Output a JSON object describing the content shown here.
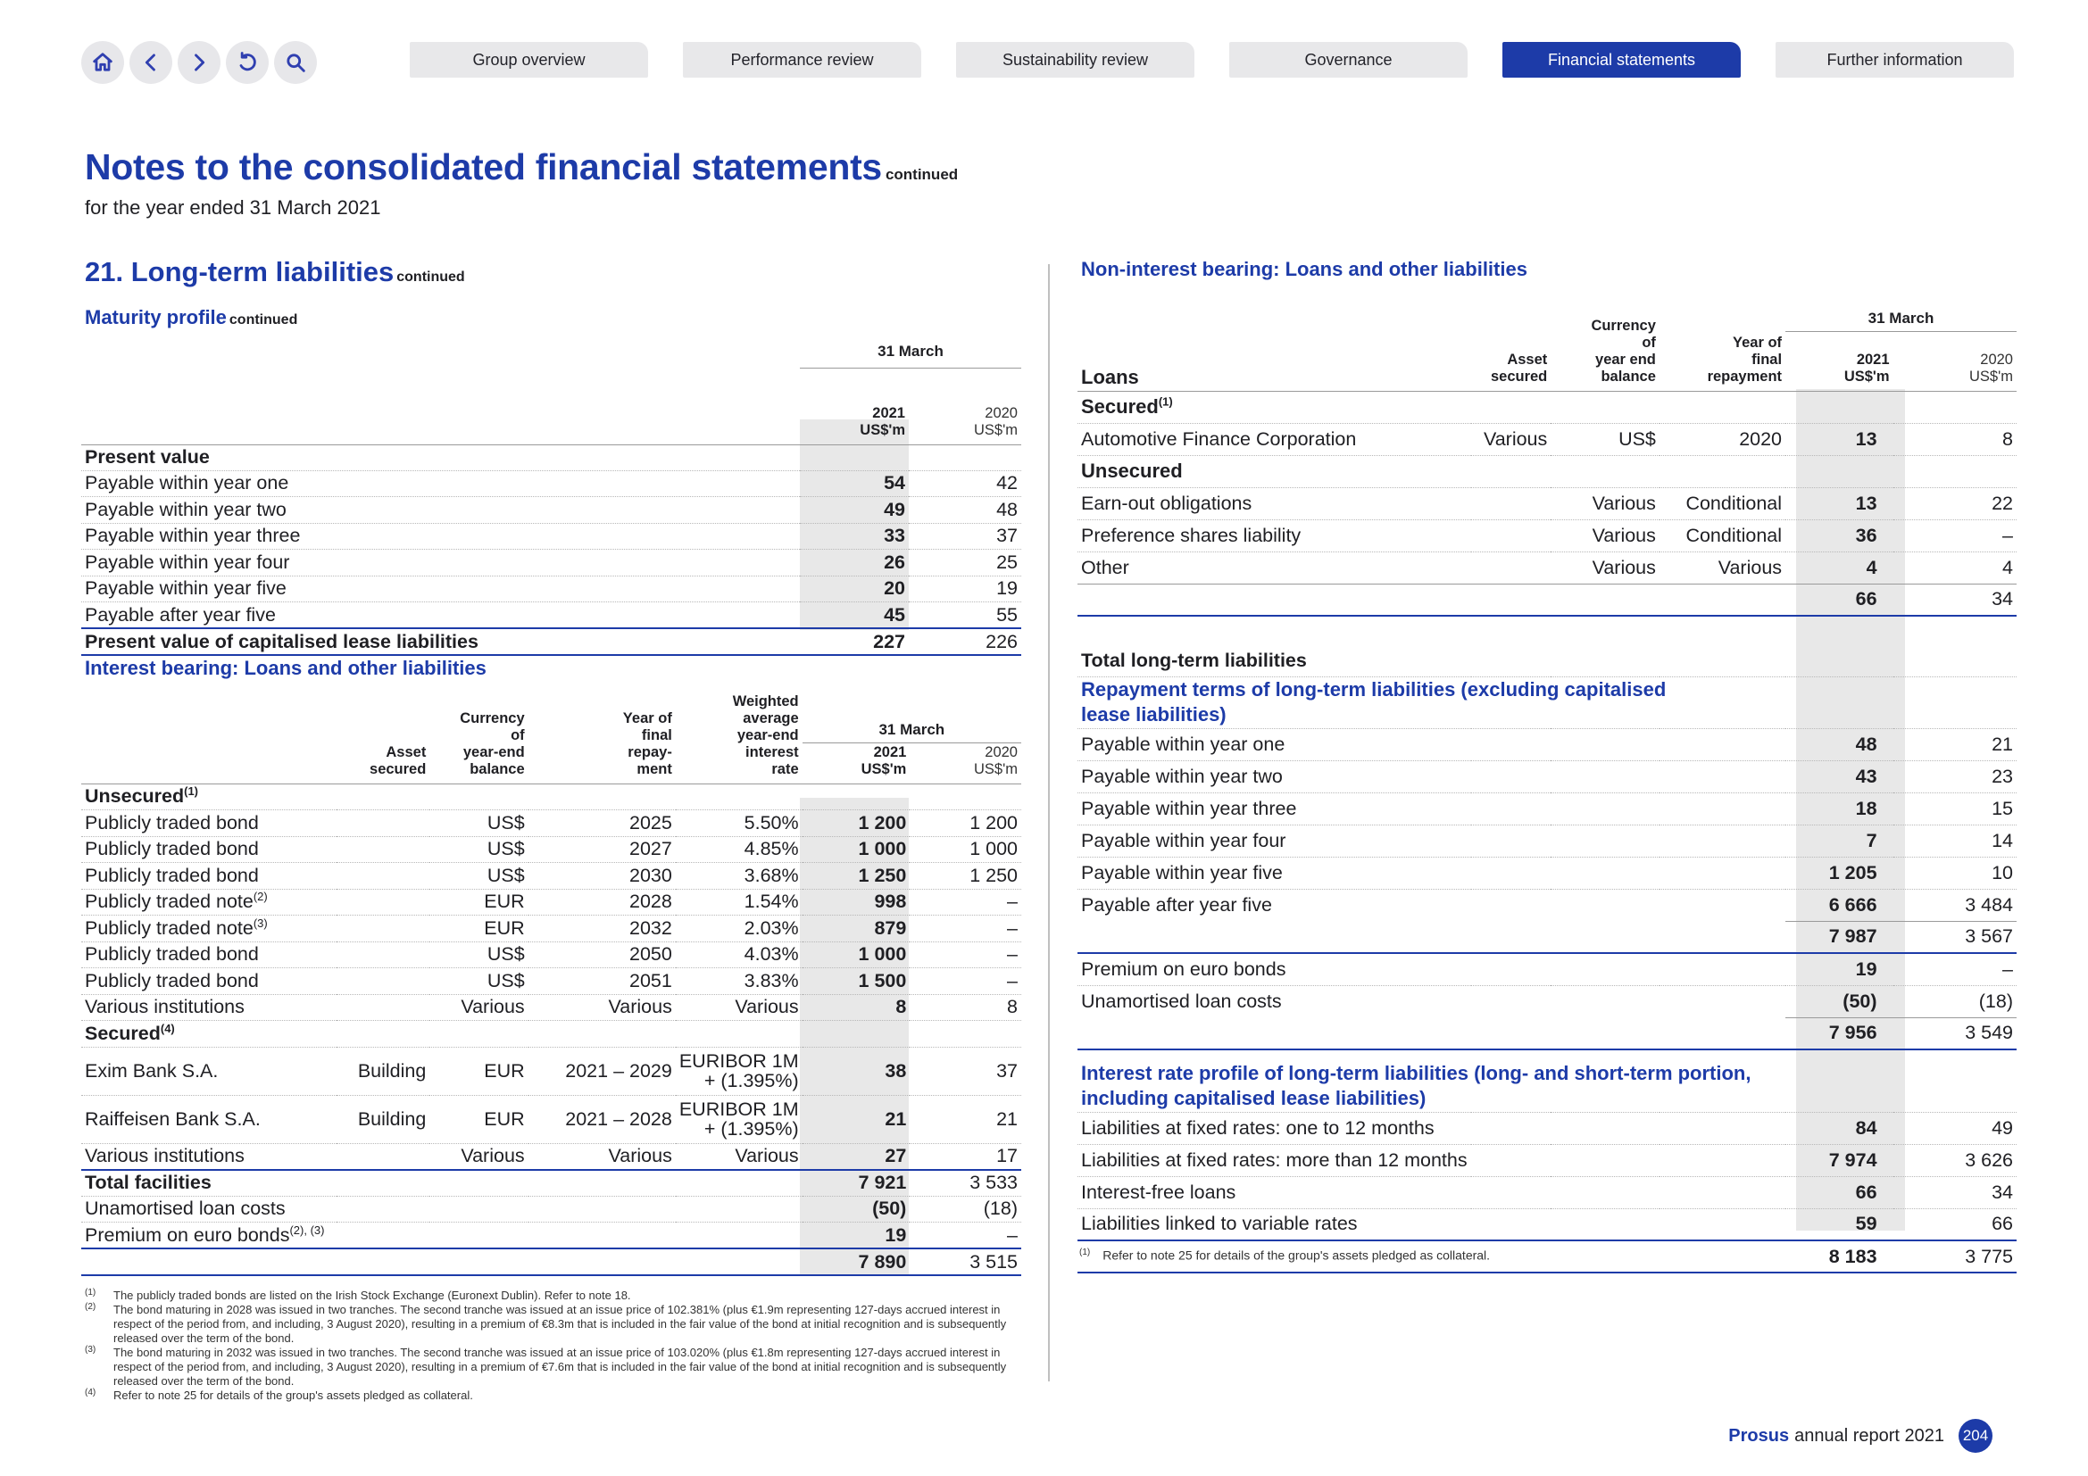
{
  "nav": {
    "tabs": [
      "Group overview",
      "Performance review",
      "Sustainability review",
      "Governance",
      "Financial statements",
      "Further information"
    ],
    "active_tab": "Financial statements"
  },
  "header": {
    "title": "Notes to the consolidated financial statements",
    "title_suffix": "continued",
    "subtitle": "for the year ended 31 March 2021"
  },
  "section": {
    "title": "21. Long-term liabilities",
    "suffix": "continued"
  },
  "maturity": {
    "title": "Maturity profile",
    "suffix": "continued",
    "march": "31 March",
    "col2021": [
      "2021",
      "US$'m"
    ],
    "col2020": [
      "2020",
      "US$'m"
    ],
    "heading": "Present value",
    "rows": [
      {
        "label": "Payable within year one",
        "v2021": "54",
        "v2020": "42"
      },
      {
        "label": "Payable within year two",
        "v2021": "49",
        "v2020": "48"
      },
      {
        "label": "Payable within year three",
        "v2021": "33",
        "v2020": "37"
      },
      {
        "label": "Payable within year four",
        "v2021": "26",
        "v2020": "25"
      },
      {
        "label": "Payable within year five",
        "v2021": "20",
        "v2020": "19"
      },
      {
        "label": "Payable after year five",
        "v2021": "45",
        "v2020": "55"
      }
    ],
    "total": {
      "label": "Present value of capitalised lease liabilities",
      "v2021": "227",
      "v2020": "226"
    }
  },
  "interest": {
    "title": "Interest bearing: Loans and other liabilities",
    "headers": {
      "asset": [
        "Asset",
        "secured"
      ],
      "currency": [
        "Currency",
        "of",
        "year-end",
        "balance"
      ],
      "year": [
        "Year of",
        "final",
        "repay-",
        "ment"
      ],
      "rate": [
        "Weighted",
        "average",
        "year-end",
        "interest",
        "rate"
      ],
      "march": "31 March",
      "c2021": [
        "2021",
        "US$'m"
      ],
      "c2020": [
        "2020",
        "US$'m"
      ]
    },
    "unsecured_label": "Unsecured",
    "unsecured_sup": "(1)",
    "unsecured": [
      {
        "label": "Publicly traded bond",
        "sup": "",
        "asset": "",
        "cur": "US$",
        "year": "2025",
        "rate": "5.50%",
        "v2021": "1 200",
        "v2020": "1 200"
      },
      {
        "label": "Publicly traded bond",
        "sup": "",
        "asset": "",
        "cur": "US$",
        "year": "2027",
        "rate": "4.85%",
        "v2021": "1 000",
        "v2020": "1 000"
      },
      {
        "label": "Publicly traded bond",
        "sup": "",
        "asset": "",
        "cur": "US$",
        "year": "2030",
        "rate": "3.68%",
        "v2021": "1 250",
        "v2020": "1 250"
      },
      {
        "label": "Publicly traded note",
        "sup": "(2)",
        "asset": "",
        "cur": "EUR",
        "year": "2028",
        "rate": "1.54%",
        "v2021": "998",
        "v2020": "–"
      },
      {
        "label": "Publicly traded note",
        "sup": "(3)",
        "asset": "",
        "cur": "EUR",
        "year": "2032",
        "rate": "2.03%",
        "v2021": "879",
        "v2020": "–"
      },
      {
        "label": "Publicly traded bond",
        "sup": "",
        "asset": "",
        "cur": "US$",
        "year": "2050",
        "rate": "4.03%",
        "v2021": "1 000",
        "v2020": "–"
      },
      {
        "label": "Publicly traded bond",
        "sup": "",
        "asset": "",
        "cur": "US$",
        "year": "2051",
        "rate": "3.83%",
        "v2021": "1 500",
        "v2020": "–"
      },
      {
        "label": "Various institutions",
        "sup": "",
        "asset": "",
        "cur": "Various",
        "year": "Various",
        "rate": "Various",
        "v2021": "8",
        "v2020": "8"
      }
    ],
    "secured_label": "Secured",
    "secured_sup": "(4)",
    "secured": [
      {
        "label": "Exim Bank S.A.",
        "asset": "Building",
        "cur": "EUR",
        "year": "2021 – 2029",
        "rate1": "EURIBOR 1M",
        "rate2": "+ (1.395%)",
        "v2021": "38",
        "v2020": "37"
      },
      {
        "label": "Raiffeisen Bank S.A.",
        "asset": "Building",
        "cur": "EUR",
        "year": "2021 – 2028",
        "rate1": "EURIBOR 1M",
        "rate2": "+ (1.395%)",
        "v2021": "21",
        "v2020": "21"
      }
    ],
    "various": {
      "label": "Various institutions",
      "asset": "",
      "cur": "Various",
      "year": "Various",
      "rate": "Various",
      "v2021": "27",
      "v2020": "17"
    },
    "total": {
      "label": "Total facilities",
      "v2021": "7 921",
      "v2020": "3 533"
    },
    "unamortised": {
      "label": "Unamortised loan costs",
      "v2021": "(50)",
      "v2020": "(18)"
    },
    "premium": {
      "label": "Premium on euro bonds",
      "sup": "(2), (3)",
      "v2021": "19",
      "v2020": "–"
    },
    "net": {
      "v2021": "7 890",
      "v2020": "3 515"
    }
  },
  "footnotes": [
    {
      "mark": "(1)",
      "text": "The publicly traded bonds are listed on the Irish Stock Exchange (Euronext Dublin). Refer to note 18."
    },
    {
      "mark": "(2)",
      "text": "The bond maturing in 2028 was issued in two tranches. The second tranche was issued at an issue price of 102.381% (plus €1.9m representing 127-days accrued interest in respect of the period from, and including, 3 August 2020), resulting in a premium of €8.3m that is included in the fair value of the bond at initial recognition and is subsequently released over the term of the bond."
    },
    {
      "mark": "(3)",
      "text": "The bond maturing in 2032 was issued in two tranches. The second tranche was issued at an issue price of 103.020% (plus €1.8m representing 127-days accrued interest in respect of the period from, and including, 3 August 2020), resulting in a premium of €7.6m that is included in the fair value of the bond at initial recognition and is subsequently released over the term of the bond."
    },
    {
      "mark": "(4)",
      "text": "Refer to note 25 for details of the group's assets pledged as collateral."
    }
  ],
  "noninterest": {
    "title": "Non-interest bearing: Loans and other liabilities",
    "headers": {
      "loans": "Loans",
      "asset": [
        "Asset",
        "secured"
      ],
      "currency": [
        "Currency",
        "of",
        "year end",
        "balance"
      ],
      "year": [
        "Year of",
        "final",
        "repayment"
      ],
      "march": "31 March",
      "c2021": [
        "2021",
        "US$'m"
      ],
      "c2020": [
        "2020",
        "US$'m"
      ]
    },
    "secured_label": "Secured",
    "secured_sup": "(1)",
    "secured": [
      {
        "label": "Automotive Finance Corporation",
        "asset": "Various",
        "cur": "US$",
        "year": "2020",
        "v2021": "13",
        "v2020": "8"
      }
    ],
    "unsecured_label": "Unsecured",
    "unsecured": [
      {
        "label": "Earn-out obligations",
        "asset": "",
        "cur": "Various",
        "year": "Conditional",
        "v2021": "13",
        "v2020": "22"
      },
      {
        "label": "Preference shares liability",
        "asset": "",
        "cur": "Various",
        "year": "Conditional",
        "v2021": "36",
        "v2020": "–"
      },
      {
        "label": "Other",
        "asset": "",
        "cur": "Various",
        "year": "Various",
        "v2021": "4",
        "v2020": "4"
      }
    ],
    "subtotal": {
      "v2021": "66",
      "v2020": "34"
    },
    "total_label": "Total long-term liabilities",
    "repayment_title": "Repayment terms of long-term liabilities (excluding capitalised lease liabilities)",
    "repayment": [
      {
        "label": "Payable within year one",
        "v2021": "48",
        "v2020": "21"
      },
      {
        "label": "Payable within year two",
        "v2021": "43",
        "v2020": "23"
      },
      {
        "label": "Payable within year three",
        "v2021": "18",
        "v2020": "15"
      },
      {
        "label": "Payable within year four",
        "v2021": "7",
        "v2020": "14"
      },
      {
        "label": "Payable within year five",
        "v2021": "1 205",
        "v2020": "10"
      },
      {
        "label": "Payable after year five",
        "v2021": "6 666",
        "v2020": "3 484"
      }
    ],
    "repayment_total": {
      "v2021": "7 987",
      "v2020": "3 567"
    },
    "premium": {
      "label": "Premium on euro bonds",
      "v2021": "19",
      "v2020": "–"
    },
    "unamortised": {
      "label": "Unamortised loan costs",
      "v2021": "(50)",
      "v2020": "(18)"
    },
    "adjusted_total": {
      "v2021": "7 956",
      "v2020": "3 549"
    },
    "rate_title": "Interest rate profile of long-term liabilities (long- and short-term portion, including capitalised lease liabilities)",
    "rates": [
      {
        "label": "Liabilities at fixed rates: one to 12 months",
        "v2021": "84",
        "v2020": "49"
      },
      {
        "label": "Liabilities at fixed rates: more than 12 months",
        "v2021": "7 974",
        "v2020": "3 626"
      },
      {
        "label": "Interest-free loans",
        "v2021": "66",
        "v2020": "34"
      },
      {
        "label": "Liabilities linked to variable rates",
        "v2021": "59",
        "v2020": "66"
      }
    ],
    "rates_total": {
      "v2021": "8 183",
      "v2020": "3 775"
    }
  },
  "footnote_right": {
    "mark": "(1)",
    "text": "Refer to note 25 for details of the group's assets pledged as collateral."
  },
  "footer": {
    "brand": "Prosus",
    "text": "annual report 2021",
    "page": "204"
  }
}
